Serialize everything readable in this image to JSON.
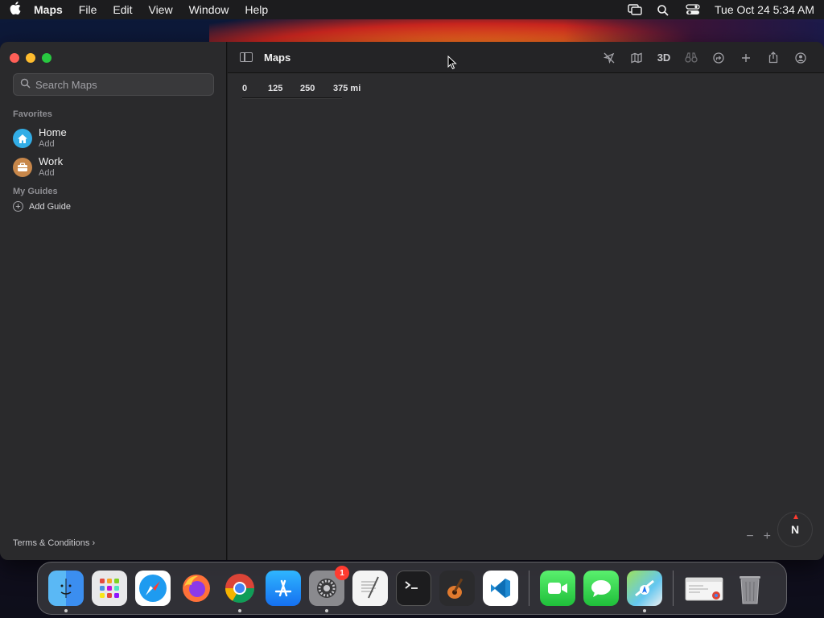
{
  "menubar": {
    "app_name": "Maps",
    "items": [
      "File",
      "Edit",
      "View",
      "Window",
      "Help"
    ],
    "clock": "Tue Oct 24  5:34 AM"
  },
  "window": {
    "title": "Maps",
    "search": {
      "placeholder": "Search Maps"
    },
    "favorites": {
      "title": "Favorites",
      "items": [
        {
          "name": "Home",
          "action": "Add",
          "color": "#32ade6",
          "icon": "house-icon"
        },
        {
          "name": "Work",
          "action": "Add",
          "color": "#c8874a",
          "icon": "briefcase-icon"
        }
      ]
    },
    "guides": {
      "title": "My Guides",
      "add_label": "Add Guide"
    },
    "terms_label": "Terms & Conditions",
    "toolbar": {
      "three_d_label": "3D",
      "icons": [
        "location-arrow-icon",
        "map-icon",
        "3d-button",
        "binoculars-icon",
        "route-icon",
        "plus-icon",
        "share-icon",
        "account-icon"
      ]
    },
    "scale": {
      "labels": [
        "0",
        "125",
        "250",
        "375 mi"
      ]
    },
    "compass_label": "N",
    "zoom": {
      "minus": "−",
      "plus": "+"
    }
  },
  "dock": {
    "items": [
      {
        "name": "Finder",
        "icon": "finder-icon",
        "running": true
      },
      {
        "name": "Launchpad",
        "icon": "launchpad-icon",
        "running": false
      },
      {
        "name": "Safari",
        "icon": "safari-icon",
        "running": false
      },
      {
        "name": "Firefox",
        "icon": "firefox-icon",
        "running": false
      },
      {
        "name": "Chrome",
        "icon": "chrome-icon",
        "running": true
      },
      {
        "name": "App Store",
        "icon": "app-store-icon",
        "running": false
      },
      {
        "name": "System Settings",
        "icon": "system-settings-icon",
        "running": true,
        "badge": "1"
      },
      {
        "name": "TextEdit",
        "icon": "textedit-icon",
        "running": false
      },
      {
        "name": "Terminal",
        "icon": "terminal-icon",
        "running": false
      },
      {
        "name": "GarageBand",
        "icon": "garageband-icon",
        "running": false
      },
      {
        "name": "VS Code",
        "icon": "vscode-icon",
        "running": false
      },
      {
        "name": "FaceTime",
        "icon": "facetime-icon",
        "running": false
      },
      {
        "name": "Messages",
        "icon": "messages-icon",
        "running": false
      },
      {
        "name": "Maps",
        "icon": "maps-icon",
        "running": true
      },
      {
        "name": "Chrome Window",
        "icon": "chrome-window-icon",
        "running": false
      },
      {
        "name": "Trash",
        "icon": "trash-icon",
        "running": false
      }
    ]
  }
}
